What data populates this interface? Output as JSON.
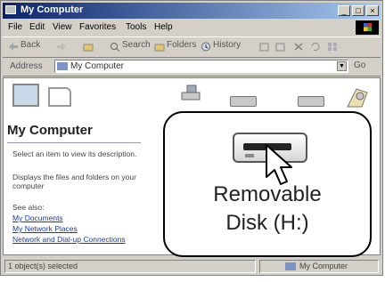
{
  "window": {
    "title": "My Computer"
  },
  "title_buttons": {
    "minimize": "_",
    "maximize": "□",
    "close": "×"
  },
  "menu": [
    "File",
    "Edit",
    "View",
    "Favorites",
    "Tools",
    "Help"
  ],
  "toolbar": {
    "back": "Back",
    "search": "Search",
    "folders": "Folders",
    "history": "History"
  },
  "address": {
    "label": "Address",
    "value": "My Computer",
    "go": "Go"
  },
  "left_pane": {
    "title": "My Computer",
    "hint": "Select an item to view its description.",
    "info": "Displays the files and folders on your computer",
    "see_also": "See also:",
    "links": [
      "My Documents",
      "My Network Places",
      "Network and Dial-up Connections"
    ]
  },
  "zoom": {
    "line1": "Removable",
    "line2": "Disk (H:)"
  },
  "status": {
    "left": "1 object(s) selected",
    "right": "My Computer"
  },
  "colors": {
    "title_start": "#0a246a",
    "title_end": "#a6caf0",
    "link": "#1a3ca0"
  },
  "icons": [
    "computer-icon",
    "removable-disk-icon",
    "mouse-pointer-icon",
    "folder-icon",
    "search-icon"
  ]
}
